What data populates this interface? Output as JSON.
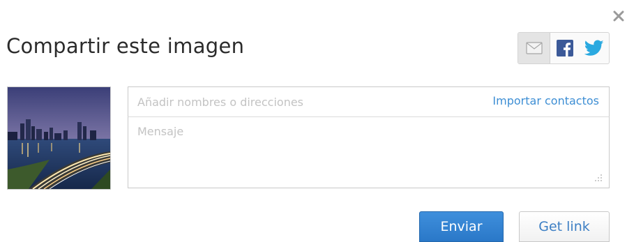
{
  "dialog": {
    "title": "Compartir este imagen",
    "close_icon": "close-icon"
  },
  "share_tabs": [
    {
      "name": "email",
      "icon": "envelope-icon",
      "selected": true
    },
    {
      "name": "facebook",
      "icon": "facebook-icon",
      "selected": false
    },
    {
      "name": "twitter",
      "icon": "twitter-bird-icon",
      "selected": false
    }
  ],
  "form": {
    "recipients_placeholder": "Añadir nombres o direcciones",
    "recipients_value": "",
    "import_contacts_label": "Importar contactos",
    "message_placeholder": "Mensaje",
    "message_value": ""
  },
  "buttons": {
    "send_label": "Enviar",
    "get_link_label": "Get link"
  },
  "colors": {
    "accent": "#3d8ed4",
    "send_button": "#2f80d0",
    "facebook": "#3b5998",
    "twitter": "#2aa9e0"
  }
}
